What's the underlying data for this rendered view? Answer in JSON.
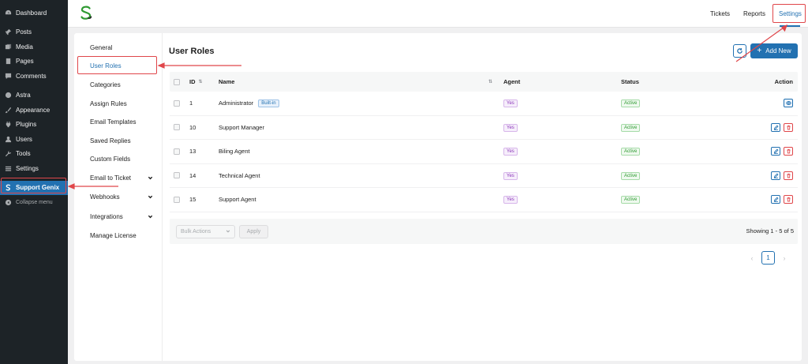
{
  "wp_menu": [
    {
      "label": "Dashboard",
      "icon": "dashboard-icon"
    },
    {
      "label": "Posts",
      "icon": "pin-icon"
    },
    {
      "label": "Media",
      "icon": "media-icon"
    },
    {
      "label": "Pages",
      "icon": "pages-icon"
    },
    {
      "label": "Comments",
      "icon": "comment-icon"
    },
    {
      "label": "Astra",
      "icon": "astra-icon"
    },
    {
      "label": "Appearance",
      "icon": "brush-icon"
    },
    {
      "label": "Plugins",
      "icon": "plugin-icon"
    },
    {
      "label": "Users",
      "icon": "user-icon"
    },
    {
      "label": "Tools",
      "icon": "wrench-icon"
    },
    {
      "label": "Settings",
      "icon": "settings-icon"
    },
    {
      "label": "Support Genix",
      "icon": "support-genix-icon"
    },
    {
      "label": "Collapse menu",
      "icon": "collapse-icon"
    }
  ],
  "header": {
    "tabs": [
      "Tickets",
      "Reports",
      "Settings"
    ],
    "active_tab": "Settings"
  },
  "subnav": [
    {
      "label": "General"
    },
    {
      "label": "User Roles",
      "active": true
    },
    {
      "label": "Categories"
    },
    {
      "label": "Assign Rules"
    },
    {
      "label": "Email Templates"
    },
    {
      "label": "Saved Replies"
    },
    {
      "label": "Custom Fields"
    },
    {
      "label": "Email to Ticket",
      "expandable": true
    },
    {
      "label": "Webhooks",
      "expandable": true
    },
    {
      "label": "Integrations",
      "expandable": true
    },
    {
      "label": "Manage License"
    }
  ],
  "page": {
    "title": "User Roles",
    "add_button": "Add New"
  },
  "table": {
    "columns": [
      "ID",
      "Name",
      "Agent",
      "Status",
      "Action"
    ],
    "rows": [
      {
        "id": "1",
        "name": "Administrator",
        "badge": "Built-in",
        "agent": "Yes",
        "status": "Active",
        "actions": [
          "view"
        ]
      },
      {
        "id": "10",
        "name": "Support Manager",
        "badge": "",
        "agent": "Yes",
        "status": "Active",
        "actions": [
          "edit",
          "delete"
        ]
      },
      {
        "id": "13",
        "name": "Biling Agent",
        "badge": "",
        "agent": "Yes",
        "status": "Active",
        "actions": [
          "edit",
          "delete"
        ]
      },
      {
        "id": "14",
        "name": "Technical Agent",
        "badge": "",
        "agent": "Yes",
        "status": "Active",
        "actions": [
          "edit",
          "delete"
        ]
      },
      {
        "id": "15",
        "name": "Support Agent",
        "badge": "",
        "agent": "Yes",
        "status": "Active",
        "actions": [
          "edit",
          "delete"
        ]
      }
    ]
  },
  "footer": {
    "bulk_actions": "Bulk Actions",
    "apply": "Apply",
    "showing": "Showing 1 - 5 of 5"
  },
  "pagination": {
    "prev": "‹",
    "current": "1",
    "next": "›"
  },
  "colors": {
    "accent": "#2271b1",
    "annotation": "#e0464a",
    "wp_sidebar": "#1d2327"
  }
}
